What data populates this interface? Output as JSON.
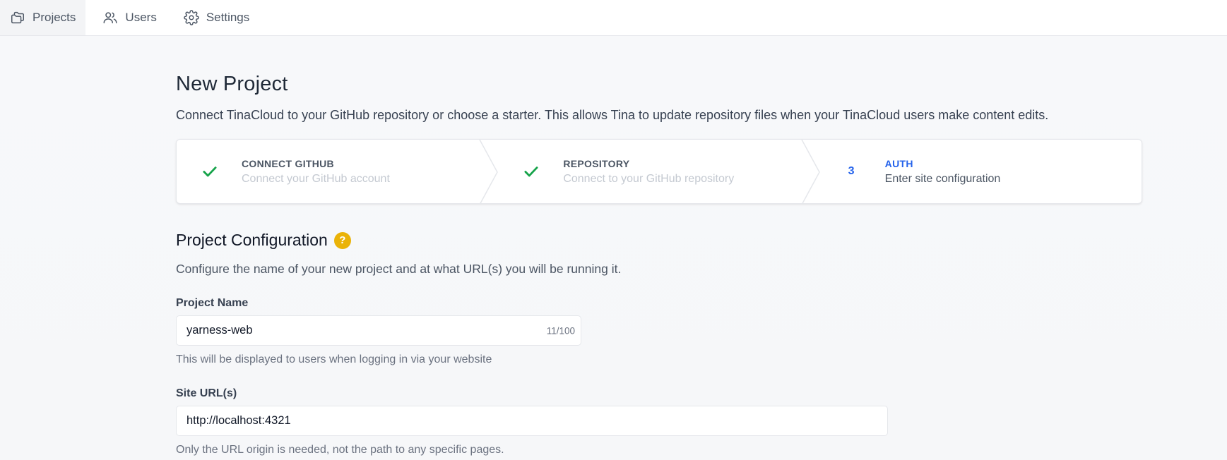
{
  "nav": {
    "items": [
      {
        "label": "Projects",
        "icon": "folders-icon",
        "active": true
      },
      {
        "label": "Users",
        "icon": "users-icon",
        "active": false
      },
      {
        "label": "Settings",
        "icon": "gear-icon",
        "active": false
      }
    ]
  },
  "page": {
    "title": "New Project",
    "description": "Connect TinaCloud to your GitHub repository or choose a starter. This allows Tina to update repository files when your TinaCloud users make content edits."
  },
  "stepper": {
    "steps": [
      {
        "status": "complete",
        "icon": "check-icon",
        "title": "CONNECT GITHUB",
        "subtitle": "Connect your GitHub account"
      },
      {
        "status": "complete",
        "icon": "check-icon",
        "title": "REPOSITORY",
        "subtitle": "Connect to your GitHub repository"
      },
      {
        "status": "current",
        "number": "3",
        "title": "AUTH",
        "subtitle": "Enter site configuration"
      }
    ]
  },
  "config": {
    "title": "Project Configuration",
    "help_icon": "question-icon",
    "help_glyph": "?",
    "description": "Configure the name of your new project and at what URL(s) you will be running it.",
    "project_name": {
      "label": "Project Name",
      "value": "yarness-web",
      "counter": "11/100",
      "helper": "This will be displayed to users when logging in via your website"
    },
    "site_urls": {
      "label": "Site URL(s)",
      "value": "http://localhost:4321",
      "helper": "Only the URL origin is needed, not the path to any specific pages."
    }
  },
  "colors": {
    "accent": "#2563eb",
    "success": "#16a34a",
    "help": "#eab308"
  }
}
